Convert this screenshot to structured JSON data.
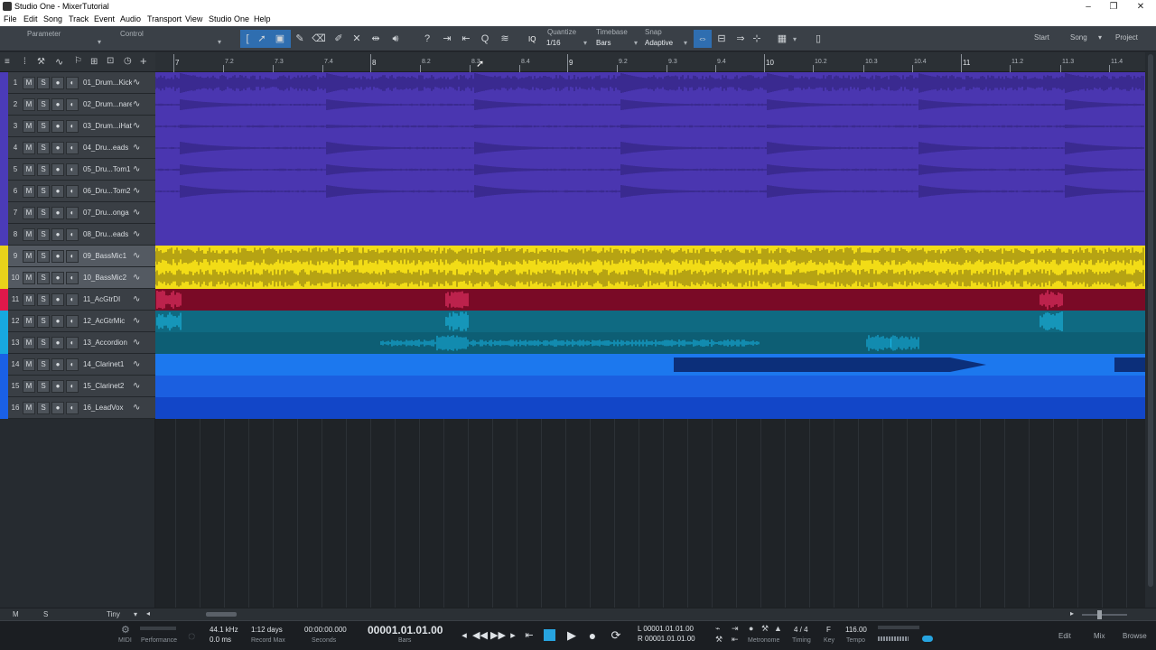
{
  "window": {
    "title": "Studio One - MixerTutorial",
    "controls": [
      "–",
      "❐",
      "✕"
    ]
  },
  "menu": [
    "File",
    "Edit",
    "Song",
    "Track",
    "Event",
    "Audio",
    "Transport",
    "View",
    "Studio One",
    "Help"
  ],
  "toolbar": {
    "parameter_label": "Parameter",
    "control_label": "Control",
    "quantize_label": "Quantize",
    "quantize_value": "1/16",
    "timebase_label": "Timebase",
    "timebase_value": "Bars",
    "snap_label": "Snap",
    "snap_value": "Adaptive",
    "iq_label": "IQ",
    "start_label": "Start",
    "song_label": "Song",
    "project_label": "Project"
  },
  "ruler": {
    "ticks": [
      {
        "label": "7",
        "major": true
      },
      {
        "label": "7.2",
        "major": false
      },
      {
        "label": "7.3",
        "major": false
      },
      {
        "label": "7.4",
        "major": false
      },
      {
        "label": "8",
        "major": true
      },
      {
        "label": "8.2",
        "major": false
      },
      {
        "label": "8.3",
        "major": false
      },
      {
        "label": "8.4",
        "major": false
      },
      {
        "label": "9",
        "major": true
      },
      {
        "label": "9.2",
        "major": false
      },
      {
        "label": "9.3",
        "major": false
      },
      {
        "label": "9.4",
        "major": false
      },
      {
        "label": "10",
        "major": true
      },
      {
        "label": "10.2",
        "major": false
      },
      {
        "label": "10.3",
        "major": false
      },
      {
        "label": "10.4",
        "major": false
      },
      {
        "label": "11",
        "major": true
      },
      {
        "label": "11.2",
        "major": false
      },
      {
        "label": "11.3",
        "major": false
      },
      {
        "label": "11.4",
        "major": false
      }
    ]
  },
  "tracks": [
    {
      "num": "1",
      "name": "01_Drum...Kick",
      "color": "#4b3bb8",
      "lane": "#4a36b0",
      "wave": "#2a1f70"
    },
    {
      "num": "2",
      "name": "02_Drum...nare",
      "color": "#4b3bb8",
      "lane": "#4a36b0",
      "wave": "#2a1f70"
    },
    {
      "num": "3",
      "name": "03_Drum...iHat",
      "color": "#4b3bb8",
      "lane": "#4a36b0",
      "wave": "#2a1f70"
    },
    {
      "num": "4",
      "name": "04_Dru...eads",
      "color": "#4b3bb8",
      "lane": "#4a36b0",
      "wave": "#2a1f70"
    },
    {
      "num": "5",
      "name": "05_Dru...Tom1",
      "color": "#4b3bb8",
      "lane": "#4a36b0",
      "wave": "#2a1f70"
    },
    {
      "num": "6",
      "name": "06_Dru...Tom2",
      "color": "#4b3bb8",
      "lane": "#4a36b0",
      "wave": "#2a1f70"
    },
    {
      "num": "7",
      "name": "07_Dru...onga",
      "color": "#4b3bb8",
      "lane": "#4a36b0",
      "wave": "#2a1f70"
    },
    {
      "num": "8",
      "name": "08_Dru...eads",
      "color": "#4b3bb8",
      "lane": "#4a36b0",
      "wave": "#2a1f70"
    },
    {
      "num": "9",
      "name": "09_BassMic1",
      "color": "#e8d21a",
      "lane": "#f2dc16",
      "wave": "#7a6a10"
    },
    {
      "num": "10",
      "name": "10_BassMic2",
      "color": "#e8d21a",
      "lane": "#f2dc16",
      "wave": "#7a6a10"
    },
    {
      "num": "11",
      "name": "11_AcGtrDI",
      "color": "#e0184a",
      "lane": "#7a0a26",
      "wave": "#ff3a72"
    },
    {
      "num": "12",
      "name": "12_AcGtrMic",
      "color": "#17a8e0",
      "lane": "#0f6a82",
      "wave": "#1cc2f0"
    },
    {
      "num": "13",
      "name": "13_Accordion",
      "color": "#17a8e0",
      "lane": "#0d5e74",
      "wave": "#18b8ea"
    },
    {
      "num": "14",
      "name": "14_Clarinet1",
      "color": "#1a60e6",
      "lane": "#1c78ee",
      "wave": "#0c2f7a"
    },
    {
      "num": "15",
      "name": "15_Clarinet2",
      "color": "#1a60e6",
      "lane": "#1b5fe0",
      "wave": "#0c2f7a"
    },
    {
      "num": "16",
      "name": "16_LeadVox",
      "color": "#1a60e6",
      "lane": "#1246c8",
      "wave": "#0c2f7a"
    }
  ],
  "track_buttons": [
    "M",
    "S",
    "●",
    "◐"
  ],
  "footer": {
    "m_label": "M",
    "s_label": "S",
    "size_label": "Tiny"
  },
  "transport": {
    "midi_label": "MIDI",
    "performance_label": "Performance",
    "sample_rate": "44.1 kHz",
    "latency": "0.0 ms",
    "record_max_value": "1:12 days",
    "record_max_label": "Record Max",
    "seconds_value": "00:00:00.000",
    "seconds_label": "Seconds",
    "bars_value": "00001.01.01.00",
    "bars_label": "Bars",
    "loop_l": "L  00001.01.01.00",
    "loop_r": "R  00001.01.01.00",
    "metronome_label": "Metronome",
    "timing_value": "4 / 4",
    "timing_label": "Timing",
    "key_value": "F",
    "key_label": "Key",
    "tempo_value": "116.00",
    "tempo_label": "Tempo",
    "edit_label": "Edit",
    "mix_label": "Mix",
    "browse_label": "Browse"
  }
}
